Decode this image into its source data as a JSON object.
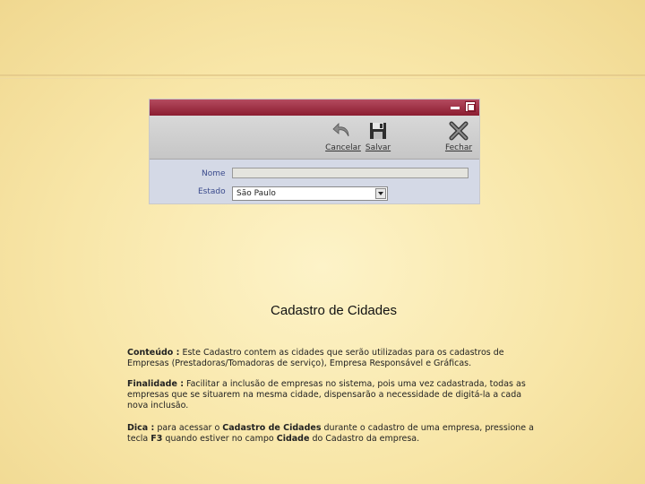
{
  "app_window": {
    "toolbar": {
      "cancel_label": "Cancelar",
      "save_label": "Salvar",
      "close_label": "Fechar"
    },
    "form": {
      "nome_label": "Nome",
      "nome_value": "",
      "estado_label": "Estado",
      "estado_value": "São Paulo"
    },
    "colors": {
      "titlebar": "#8b1c30",
      "toolbar": "#cccccc",
      "form_bg": "#d4d9e6",
      "label_text": "#3a4a8c"
    }
  },
  "slide": {
    "title": "Cadastro de Cidades",
    "paragraphs": [
      {
        "term": "Conteúdo :",
        "text": " Este Cadastro contem as cidades que serão utilizadas para os cadastros de Empresas (Prestadoras/Tomadoras de serviço), Empresa Responsável e Gráficas."
      },
      {
        "term": "Finalidade :",
        "text": " Facilitar a inclusão de empresas no sistema, pois uma vez cadastrada, todas as empresas que se situarem na mesma cidade, dispensarão a necessidade de digitá-la a cada nova inclusão."
      },
      {
        "term": "Dica :",
        "t1": " para acessar o ",
        "b1": "Cadastro de Cidades",
        "t2": " durante o cadastro de uma empresa, pressione a tecla ",
        "b2": "F3",
        "t3": " quando estiver no campo ",
        "b3": "Cidade",
        "t4": " do Cadastro da empresa."
      }
    ]
  }
}
